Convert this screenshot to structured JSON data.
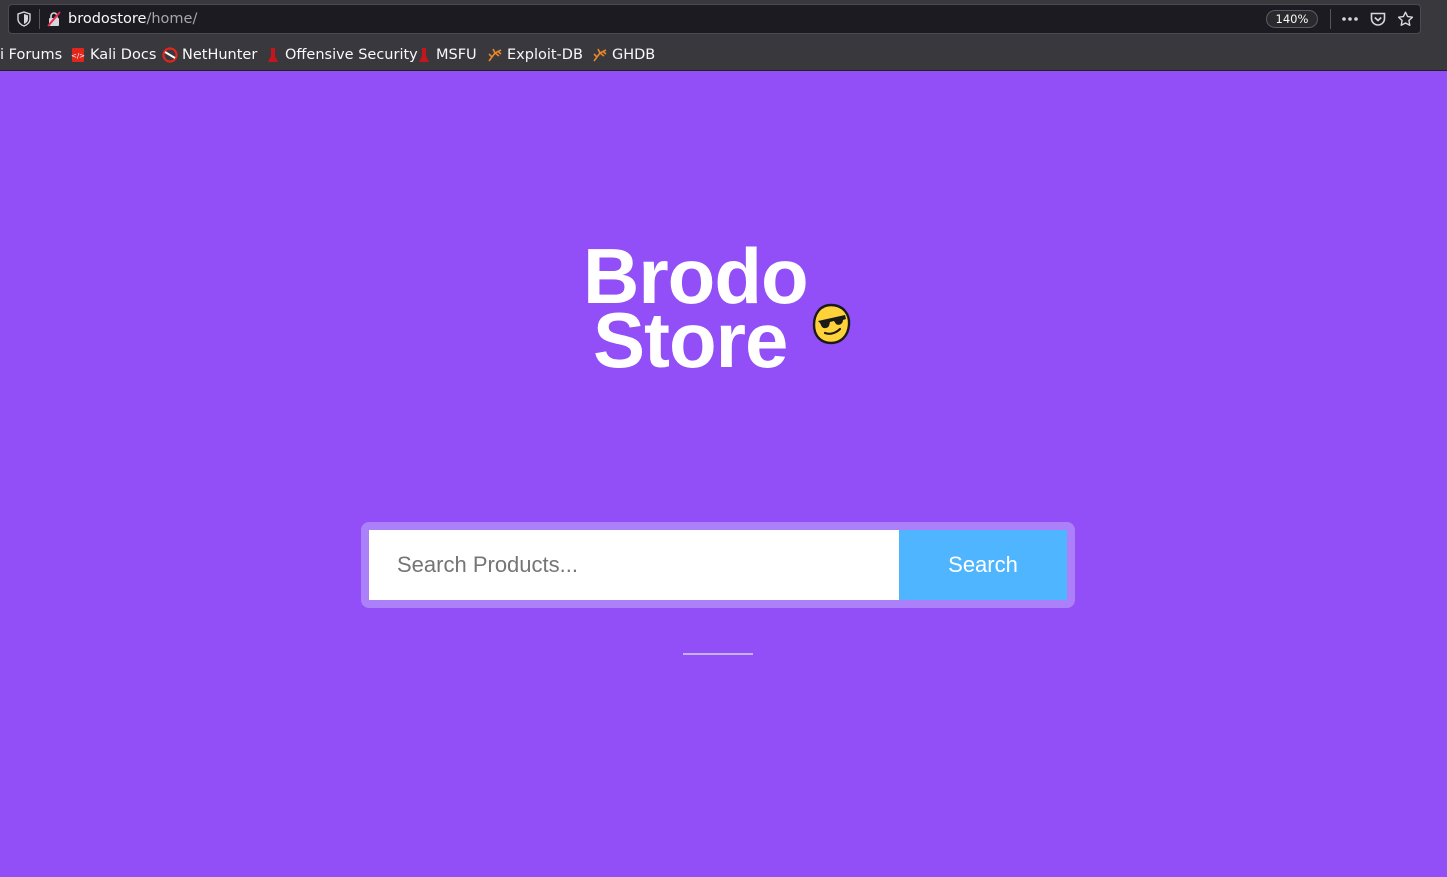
{
  "browser": {
    "url_host": "brodostore",
    "url_path": "/home/",
    "zoom": "140%",
    "actions": [
      "more-icon",
      "pocket-icon",
      "bookmark-star-icon"
    ]
  },
  "bookmarks": [
    {
      "label": "i Forums",
      "icon": "kali-icon"
    },
    {
      "label": "Kali Docs",
      "icon": "kali-docs-icon"
    },
    {
      "label": "NetHunter",
      "icon": "nethunter-icon"
    },
    {
      "label": "Offensive Security",
      "icon": "offsec-icon"
    },
    {
      "label": "MSFU",
      "icon": "msfu-icon"
    },
    {
      "label": "Exploit-DB",
      "icon": "exploitdb-icon"
    },
    {
      "label": "GHDB",
      "icon": "ghdb-icon"
    }
  ],
  "page": {
    "logo_line1": "Brodo",
    "logo_line2": "Store",
    "search_placeholder": "Search Products...",
    "search_button": "Search"
  },
  "colors": {
    "background": "#924ef7",
    "search_frame": "#ab80f8",
    "search_button": "#4fb5ff"
  }
}
